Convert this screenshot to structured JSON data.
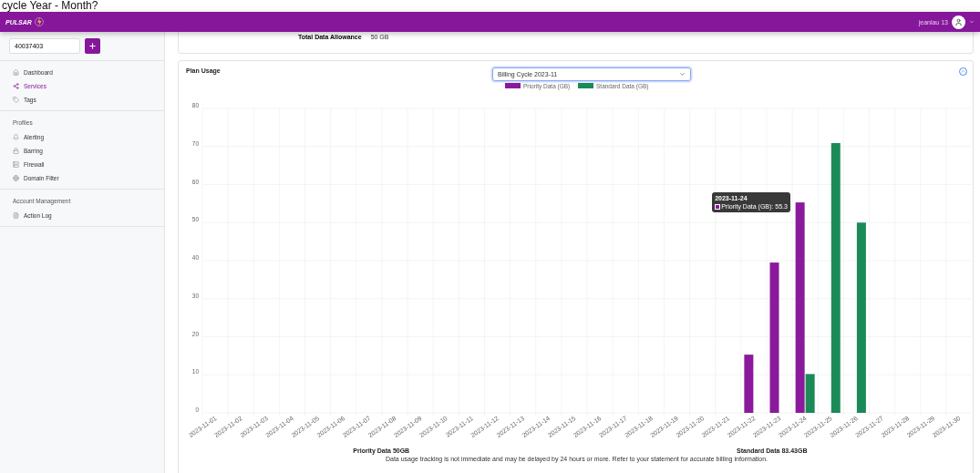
{
  "caption": "cycle Year - Month?",
  "header": {
    "logo": "PULSAR",
    "user": "jeanlau 13"
  },
  "sidebar": {
    "search": {
      "value": "40037403"
    },
    "sections": [
      {
        "items": [
          {
            "label": "Dashboard",
            "selected": false
          },
          {
            "label": "Services",
            "selected": true
          },
          {
            "label": "Tags",
            "selected": false
          }
        ]
      },
      {
        "title": "Profiles",
        "items": [
          {
            "label": "Alerting",
            "selected": false
          },
          {
            "label": "Barring",
            "selected": false
          },
          {
            "label": "Firewall",
            "selected": false
          },
          {
            "label": "Domain Filter",
            "selected": false
          }
        ]
      },
      {
        "title": "Account Management",
        "items": [
          {
            "label": "Action Log",
            "selected": false
          }
        ]
      }
    ]
  },
  "allowance": {
    "label": "Total Data Allowance",
    "value": "50 GB"
  },
  "plan_usage": {
    "title": "Plan Usage",
    "cycle_select": "Billing Cycle 2023-11",
    "chart_data": {
      "type": "bar",
      "categories": [
        "2023-11-01",
        "2023-11-02",
        "2023-11-03",
        "2023-11-04",
        "2023-11-05",
        "2023-11-06",
        "2023-11-07",
        "2023-11-08",
        "2023-11-09",
        "2023-11-10",
        "2023-11-11",
        "2023-11-12",
        "2023-11-13",
        "2023-11-14",
        "2023-11-15",
        "2023-11-16",
        "2023-11-17",
        "2023-11-18",
        "2023-11-19",
        "2023-11-20",
        "2023-11-21",
        "2023-11-22",
        "2023-11-23",
        "2023-11-24",
        "2023-11-25",
        "2023-11-26",
        "2023-11-27",
        "2023-11-28",
        "2023-11-29",
        "2023-11-30"
      ],
      "series": [
        {
          "name": "Priority Data (GB)",
          "color": "#8a1a9b",
          "values": [
            null,
            null,
            null,
            null,
            null,
            null,
            null,
            null,
            null,
            null,
            null,
            null,
            null,
            null,
            null,
            null,
            null,
            null,
            null,
            null,
            null,
            15.3,
            39.5,
            55.3,
            null,
            null,
            null,
            null,
            null,
            null
          ]
        },
        {
          "name": "Standard Data (GB)",
          "color": "#1a8a57",
          "values": [
            null,
            null,
            null,
            null,
            null,
            null,
            null,
            null,
            null,
            null,
            null,
            null,
            null,
            null,
            null,
            null,
            null,
            null,
            null,
            null,
            null,
            null,
            null,
            10.2,
            70.9,
            50.0,
            null,
            null,
            null,
            null
          ]
        }
      ],
      "ylim": [
        0,
        80
      ],
      "yticks": [
        0,
        10,
        20,
        30,
        40,
        50,
        60,
        70,
        80
      ],
      "grid": true,
      "legend": true
    },
    "tooltip": {
      "title": "2023-11-24",
      "text": "Priority Data (GB): 55.3"
    },
    "totals": [
      "Priority Data 50GB",
      "Standard Data 83.43GB"
    ],
    "notice": "Data usage tracking is not immediate and may be delayed by 24 hours or more. Refer to your statement for accurate billing information."
  }
}
